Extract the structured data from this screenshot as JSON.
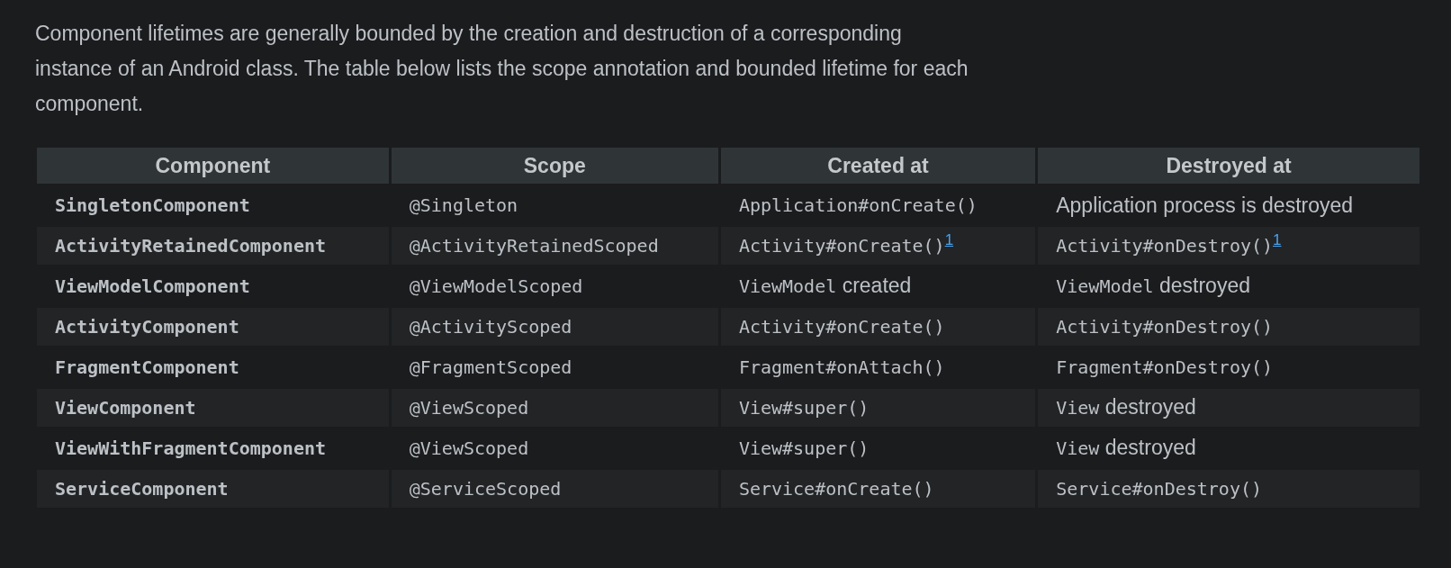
{
  "intro": "Component lifetimes are generally bounded by the creation and destruction of a corresponding instance of an Android class. The table below lists the scope annotation and bounded lifetime for each component.",
  "table": {
    "columns": [
      "Component",
      "Scope",
      "Created at",
      "Destroyed at"
    ],
    "rows": [
      [
        [
          {
            "kind": "code",
            "text": "SingletonComponent"
          }
        ],
        [
          {
            "kind": "code",
            "text": "@Singleton"
          }
        ],
        [
          {
            "kind": "code",
            "text": "Application#onCreate()"
          }
        ],
        [
          {
            "kind": "text",
            "text": "Application process is destroyed"
          }
        ]
      ],
      [
        [
          {
            "kind": "code",
            "text": "ActivityRetainedComponent"
          }
        ],
        [
          {
            "kind": "code",
            "text": "@ActivityRetainedScoped"
          }
        ],
        [
          {
            "kind": "code",
            "text": "Activity#onCreate()"
          },
          {
            "kind": "footnote",
            "text": "1"
          }
        ],
        [
          {
            "kind": "code",
            "text": "Activity#onDestroy()"
          },
          {
            "kind": "footnote",
            "text": "1"
          }
        ]
      ],
      [
        [
          {
            "kind": "code",
            "text": "ViewModelComponent"
          }
        ],
        [
          {
            "kind": "code",
            "text": "@ViewModelScoped"
          }
        ],
        [
          {
            "kind": "code",
            "text": "ViewModel"
          },
          {
            "kind": "text",
            "text": " created"
          }
        ],
        [
          {
            "kind": "code",
            "text": "ViewModel"
          },
          {
            "kind": "text",
            "text": " destroyed"
          }
        ]
      ],
      [
        [
          {
            "kind": "code",
            "text": "ActivityComponent"
          }
        ],
        [
          {
            "kind": "code",
            "text": "@ActivityScoped"
          }
        ],
        [
          {
            "kind": "code",
            "text": "Activity#onCreate()"
          }
        ],
        [
          {
            "kind": "code",
            "text": "Activity#onDestroy()"
          }
        ]
      ],
      [
        [
          {
            "kind": "code",
            "text": "FragmentComponent"
          }
        ],
        [
          {
            "kind": "code",
            "text": "@FragmentScoped"
          }
        ],
        [
          {
            "kind": "code",
            "text": "Fragment#onAttach()"
          }
        ],
        [
          {
            "kind": "code",
            "text": "Fragment#onDestroy()"
          }
        ]
      ],
      [
        [
          {
            "kind": "code",
            "text": "ViewComponent"
          }
        ],
        [
          {
            "kind": "code",
            "text": "@ViewScoped"
          }
        ],
        [
          {
            "kind": "code",
            "text": "View#super()"
          }
        ],
        [
          {
            "kind": "code",
            "text": "View"
          },
          {
            "kind": "text",
            "text": " destroyed"
          }
        ]
      ],
      [
        [
          {
            "kind": "code",
            "text": "ViewWithFragmentComponent"
          }
        ],
        [
          {
            "kind": "code",
            "text": "@ViewScoped"
          }
        ],
        [
          {
            "kind": "code",
            "text": "View#super()"
          }
        ],
        [
          {
            "kind": "code",
            "text": "View"
          },
          {
            "kind": "text",
            "text": " destroyed"
          }
        ]
      ],
      [
        [
          {
            "kind": "code",
            "text": "ServiceComponent"
          }
        ],
        [
          {
            "kind": "code",
            "text": "@ServiceScoped"
          }
        ],
        [
          {
            "kind": "code",
            "text": "Service#onCreate()"
          }
        ],
        [
          {
            "kind": "code",
            "text": "Service#onDestroy()"
          }
        ]
      ]
    ]
  }
}
